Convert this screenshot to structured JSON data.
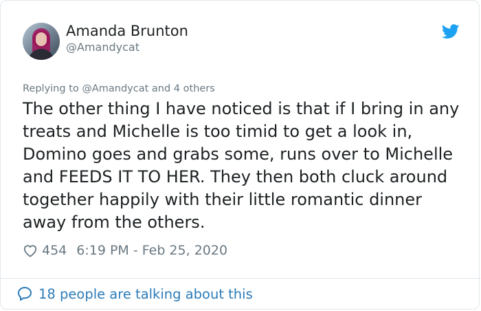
{
  "author": {
    "name": "Amanda Brunton",
    "handle": "@Amandycat"
  },
  "reply": {
    "prefix": "Replying to ",
    "mention": "@Amandycat",
    "suffix": " and 4 others"
  },
  "tweet": {
    "text": "The other thing I have noticed is that if I bring in any\ntreats and Michelle is too timid to get a look in,\nDomino goes and grabs some, runs over to Michelle\nand FEEDS IT TO HER. They then both cluck around\ntogether happily with their little romantic dinner\naway from the others."
  },
  "meta": {
    "likes": "454",
    "timestamp": "6:19 PM - Feb 25, 2020"
  },
  "footer": {
    "talking": "18 people are talking about this"
  },
  "icons": {
    "brand": "twitter-bird-icon",
    "like": "heart-icon",
    "reply": "speech-bubble-icon"
  },
  "colors": {
    "brand": "#1da1f2",
    "link": "#2b7bb9",
    "muted": "#697882",
    "text": "#1c2022"
  }
}
